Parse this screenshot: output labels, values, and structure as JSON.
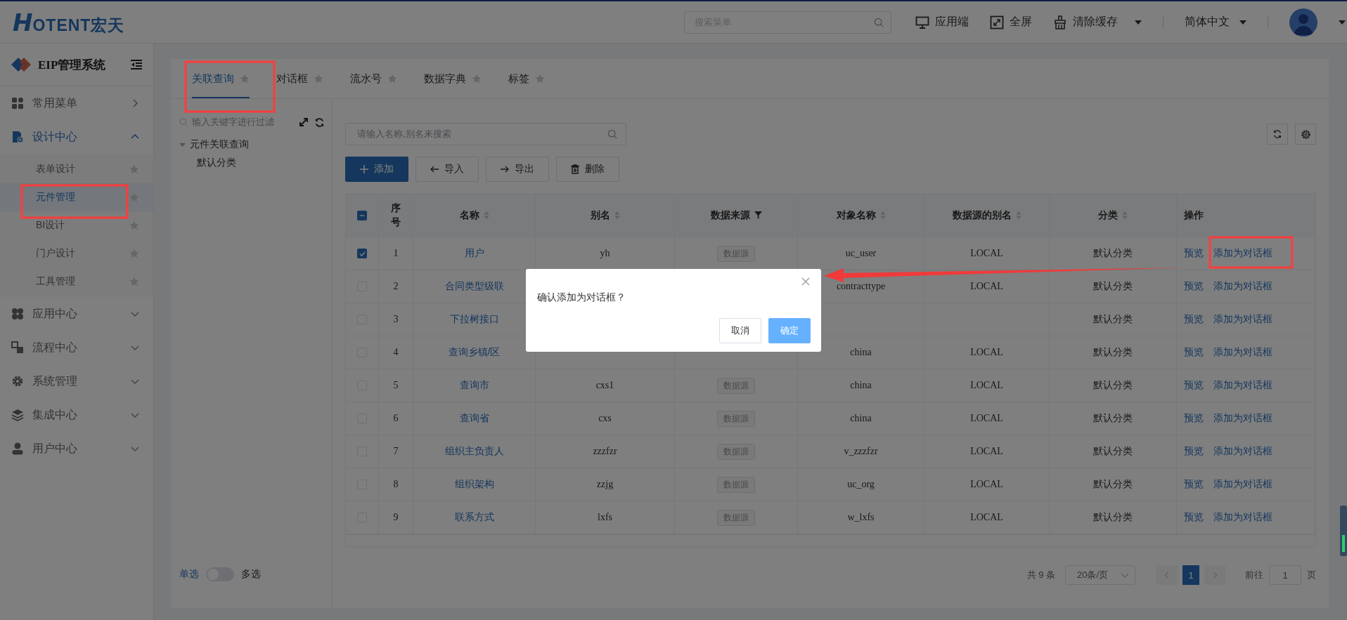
{
  "header": {
    "logo_mark": "H",
    "logo_text": "OTENT宏天",
    "search": {
      "placeholder": "搜索菜单"
    },
    "actions": [
      {
        "label": "应用端",
        "kind": "monitor",
        "dropdown": false
      },
      {
        "label": "全屏",
        "kind": "fullscreen",
        "dropdown": false
      },
      {
        "label": "清除缓存",
        "kind": "broom",
        "dropdown": true
      }
    ],
    "language": "简体中文"
  },
  "sidebar": {
    "title": "EIP管理系统",
    "items": [
      {
        "label": "常用菜单",
        "kind": "link",
        "selected": false
      },
      {
        "label": "设计中心",
        "kind": "group",
        "selected": true,
        "expanded": true,
        "children": [
          {
            "label": "表单设计",
            "selected": false
          },
          {
            "label": "元件管理",
            "selected": true
          },
          {
            "label": "BI设计",
            "selected": false
          },
          {
            "label": "门户设计",
            "selected": false
          },
          {
            "label": "工具管理",
            "selected": false
          }
        ]
      },
      {
        "label": "应用中心",
        "kind": "group",
        "selected": false,
        "expanded": false
      },
      {
        "label": "流程中心",
        "kind": "group",
        "selected": false,
        "expanded": false
      },
      {
        "label": "系统管理",
        "kind": "group",
        "selected": false,
        "expanded": false
      },
      {
        "label": "集成中心",
        "kind": "group",
        "selected": false,
        "expanded": false
      },
      {
        "label": "用户中心",
        "kind": "group",
        "selected": false,
        "expanded": false
      }
    ]
  },
  "tabs": [
    {
      "label": "关联查询",
      "selected": true
    },
    {
      "label": "对话框",
      "selected": false
    },
    {
      "label": "流水号",
      "selected": false
    },
    {
      "label": "数据字典",
      "selected": false
    },
    {
      "label": "标签",
      "selected": false
    }
  ],
  "tree": {
    "placeholder": "输入关键字进行过滤",
    "nodes": [
      {
        "label": "元件关联查询",
        "expanded": true,
        "children": [
          {
            "label": "默认分类"
          }
        ]
      }
    ]
  },
  "select_mode": {
    "single": "单选",
    "multiple": "多选",
    "on": false
  },
  "table": {
    "search_placeholder": "请输入名称,别名来搜索",
    "buttons": [
      {
        "label": "添加",
        "kind": "add"
      },
      {
        "label": "导入",
        "kind": "import"
      },
      {
        "label": "导出",
        "kind": "export"
      },
      {
        "label": "删除",
        "kind": "delete"
      }
    ],
    "header_checkbox": {
      "indeterminate": true
    },
    "columns": [
      {
        "label": "序号",
        "sortable": false,
        "filterable": false
      },
      {
        "label": "名称",
        "sortable": true,
        "filterable": false
      },
      {
        "label": "别名",
        "sortable": true,
        "filterable": false
      },
      {
        "label": "数据来源",
        "sortable": false,
        "filterable": true
      },
      {
        "label": "对象名称",
        "sortable": true,
        "filterable": false
      },
      {
        "label": "数据源的别名",
        "sortable": true,
        "filterable": false
      },
      {
        "label": "分类",
        "sortable": true,
        "filterable": false
      },
      {
        "label": "操作",
        "sortable": false,
        "filterable": false
      }
    ],
    "rows": [
      {
        "checked": true,
        "index": "1",
        "name": "用户",
        "alias": "yh",
        "source": "数据源",
        "object": "uc_user",
        "ds_alias": "LOCAL",
        "category": "默认分类",
        "actions": [
          {
            "label": "预览"
          },
          {
            "label": "添加为对话框"
          }
        ]
      },
      {
        "checked": false,
        "index": "2",
        "name": "合同类型级联",
        "object": "contracttype",
        "ds_alias": "LOCAL",
        "category": "默认分类",
        "actions": [
          {
            "label": "预览"
          },
          {
            "label": "添加为对话框"
          }
        ]
      },
      {
        "checked": false,
        "index": "3",
        "name": "下拉树接口",
        "category": "默认分类",
        "actions": [
          {
            "label": "预览"
          },
          {
            "label": "添加为对话框"
          }
        ]
      },
      {
        "checked": false,
        "index": "4",
        "name": "查询乡镇/区",
        "object": "china",
        "ds_alias": "LOCAL",
        "category": "默认分类",
        "actions": [
          {
            "label": "预览"
          },
          {
            "label": "添加为对话框"
          }
        ]
      },
      {
        "checked": false,
        "index": "5",
        "name": "查询市",
        "alias": "cxs1",
        "source": "数据源",
        "object": "china",
        "ds_alias": "LOCAL",
        "category": "默认分类",
        "actions": [
          {
            "label": "预览"
          },
          {
            "label": "添加为对话框"
          }
        ]
      },
      {
        "checked": false,
        "index": "6",
        "name": "查询省",
        "alias": "cxs",
        "source": "数据源",
        "object": "china",
        "ds_alias": "LOCAL",
        "category": "默认分类",
        "actions": [
          {
            "label": "预览"
          },
          {
            "label": "添加为对话框"
          }
        ]
      },
      {
        "checked": false,
        "index": "7",
        "name": "组织主负责人",
        "alias": "zzzfzr",
        "source": "数据源",
        "object": "v_zzzfzr",
        "ds_alias": "LOCAL",
        "category": "默认分类",
        "actions": [
          {
            "label": "预览"
          },
          {
            "label": "添加为对话框"
          }
        ]
      },
      {
        "checked": false,
        "index": "8",
        "name": "组织架构",
        "alias": "zzjg",
        "source": "数据源",
        "object": "uc_org",
        "ds_alias": "LOCAL",
        "category": "默认分类",
        "actions": [
          {
            "label": "预览"
          },
          {
            "label": "添加为对话框"
          }
        ]
      },
      {
        "checked": false,
        "index": "9",
        "name": "联系方式",
        "alias": "lxfs",
        "source": "数据源",
        "object": "w_lxfs",
        "ds_alias": "LOCAL",
        "category": "默认分类",
        "actions": [
          {
            "label": "预览"
          },
          {
            "label": "添加为对话框"
          }
        ]
      }
    ],
    "pagination": {
      "total": "共 9 条",
      "page_size": "20条/页",
      "pages": [
        {
          "label": "1",
          "selected": true
        }
      ],
      "goto_label": "前往",
      "goto_value": "1",
      "page_suffix": "页"
    }
  },
  "dialog": {
    "message": "确认添加为对话框？",
    "buttons": [
      {
        "label": "取消",
        "kind": "default"
      },
      {
        "label": "确定",
        "kind": "primary"
      }
    ]
  }
}
